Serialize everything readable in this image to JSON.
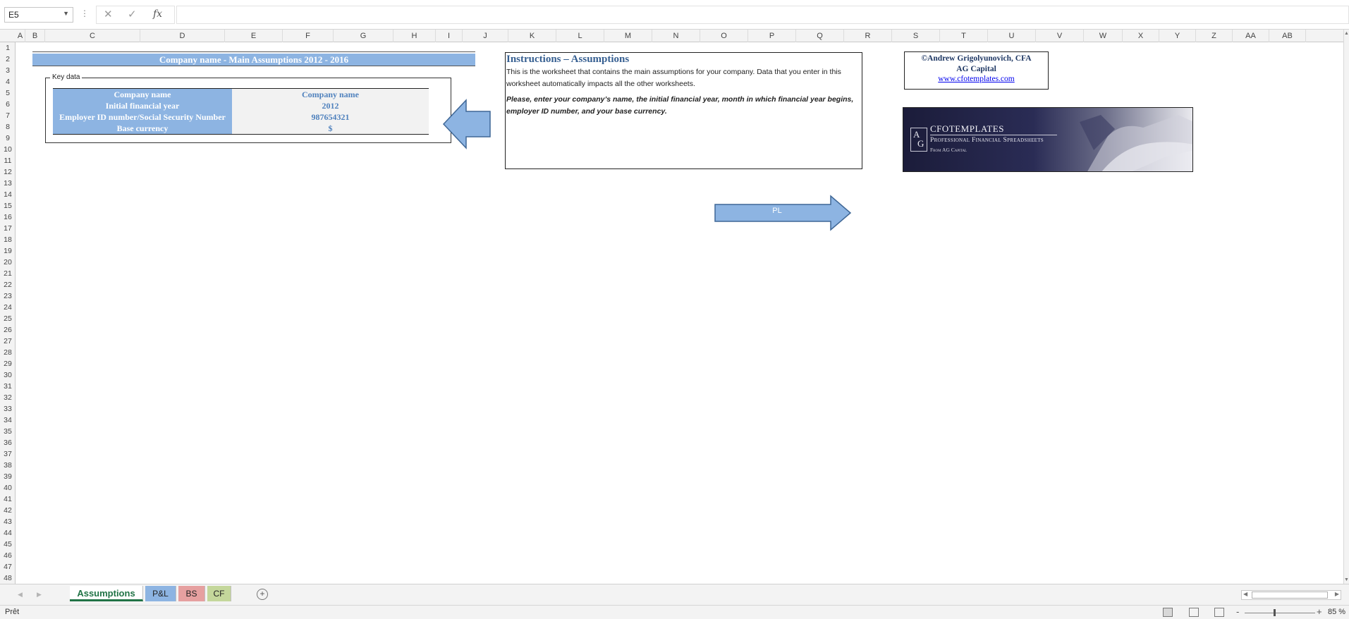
{
  "formula_bar": {
    "name_box": "E5",
    "separator": "⋮",
    "cancel_icon": "✕",
    "enter_icon": "✓",
    "fx_label": "fx",
    "formula": ""
  },
  "columns": [
    "A",
    "B",
    "C",
    "D",
    "E",
    "F",
    "G",
    "H",
    "I",
    "J",
    "K",
    "L",
    "M",
    "N",
    "O",
    "P",
    "Q",
    "R",
    "S",
    "T",
    "U",
    "V",
    "W",
    "X",
    "Y",
    "Z",
    "AA",
    "AB"
  ],
  "rows": [
    "1",
    "2",
    "3",
    "4",
    "5",
    "6",
    "7",
    "8",
    "9",
    "10",
    "11",
    "12",
    "13",
    "14",
    "15",
    "16",
    "17",
    "18",
    "19",
    "20",
    "21",
    "22",
    "23",
    "24",
    "25",
    "26",
    "27",
    "28",
    "29",
    "30",
    "31",
    "32",
    "33",
    "34",
    "35",
    "36",
    "37",
    "38",
    "39",
    "40",
    "41",
    "42",
    "43",
    "44",
    "45",
    "46",
    "47",
    "48"
  ],
  "sheet": {
    "title": "Company name - Main Assumptions 2012 - 2016",
    "key_data": {
      "legend": "Key data",
      "rows": [
        {
          "label": "Company name",
          "value": "Company name"
        },
        {
          "label": "Initial financial year",
          "value": "2012"
        },
        {
          "label": "Employer ID number/Social Security Number",
          "value": "987654321"
        },
        {
          "label": "Base currency",
          "value": "$"
        }
      ]
    },
    "instructions": {
      "title": "Instructions – Assumptions",
      "body": "This is the worksheet that contains the main assumptions for your company. Data that you enter in this worksheet automatically impacts all the other worksheets.",
      "emphasis": "Please, enter your company’s name, the initial financial year, month in which financial year begins, employer ID number, and your base currency."
    },
    "pl_arrow_label": "PL",
    "copyright": {
      "name": "©Andrew Grigolyunovich, CFA",
      "company": "AG Capital",
      "link": "www.cfotemplates.com"
    },
    "banner": {
      "logo_a": "A",
      "logo_g": "G",
      "title": "CFOTEMPLATES",
      "subtitle": "Professional Financial Spreadsheets",
      "subtitle2": "From AG Capital"
    }
  },
  "tabs": {
    "prev_icon": "◀",
    "next_icon": "▶",
    "items": [
      "Assumptions",
      "P&L",
      "BS",
      "CF"
    ],
    "add_icon": "+"
  },
  "status_bar": {
    "status": "Prêt",
    "zoom_minus": "-",
    "zoom_plus": "+",
    "zoom": "85 %",
    "zoom_fraction": 0.85
  },
  "colors": {
    "header_blue": "#8db4e2",
    "value_blue": "#4f81bd",
    "tab_pl": "#8db4e2",
    "tab_bs": "#e6a0a0",
    "tab_cf": "#c4d79b",
    "excel_green": "#217346"
  }
}
